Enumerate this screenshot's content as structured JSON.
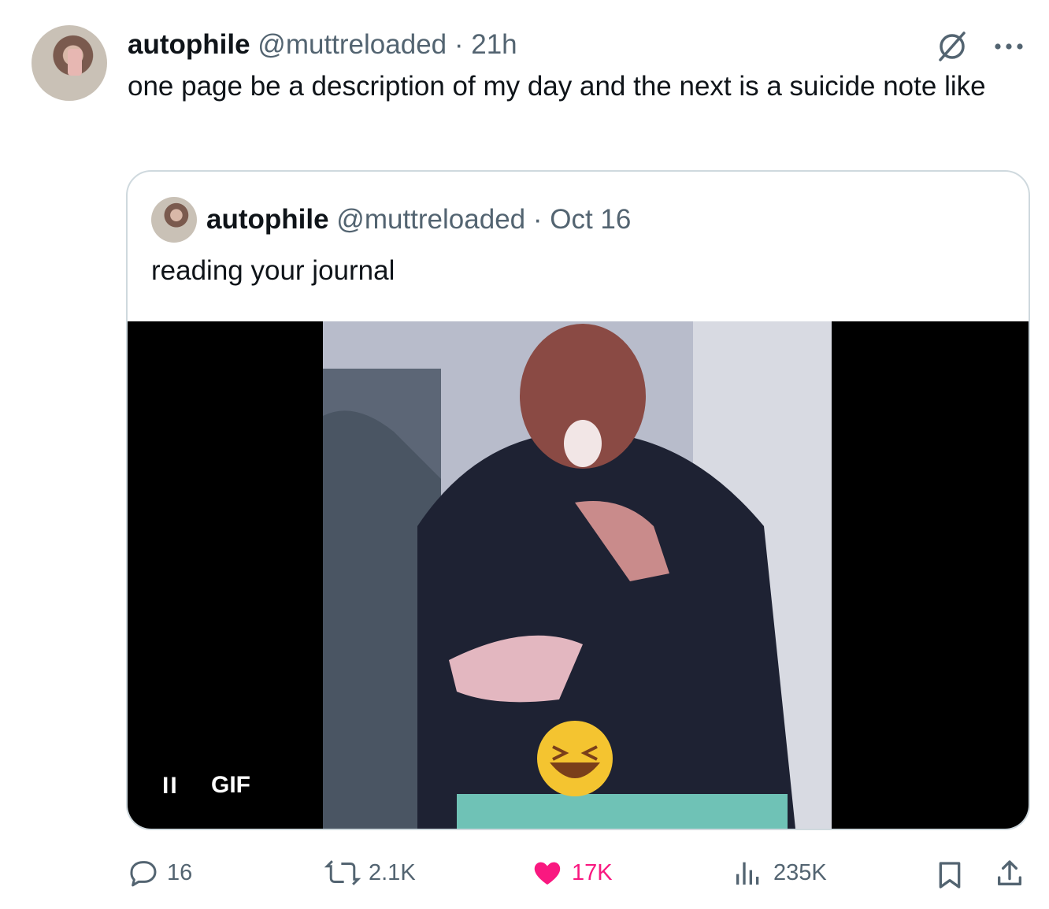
{
  "tweet": {
    "author_name": "autophile",
    "handle": "@muttreloaded",
    "separator": "·",
    "time": "21h",
    "text": "one page be a description of my day and the next is a suicide note like"
  },
  "quoted": {
    "author_name": "autophile",
    "handle": "@muttreloaded",
    "separator": "·",
    "date": "Oct 16",
    "text": "reading your journal",
    "media": {
      "pause_label": "II",
      "badge": "GIF"
    }
  },
  "actions": {
    "replies": "16",
    "reposts": "2.1K",
    "likes": "17K",
    "views": "235K"
  },
  "colors": {
    "like": "#f91880",
    "muted": "#536471",
    "border": "#cfd9de"
  }
}
